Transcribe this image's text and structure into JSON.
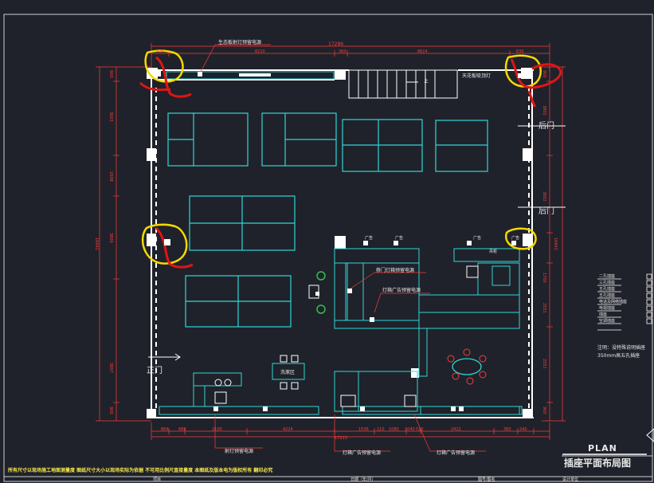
{
  "drawing": {
    "title_en": "PLAN",
    "title_cn": "插座平面布局图",
    "footer_note": "所有尺寸以现场施工地面测量度  图纸尺寸大小以现场实际为依据  不可用比例尺直接量度  本图纸及版本电为版权所有  翻印必究",
    "footer_cells": [
      "项目",
      "日期（年/月）",
      "图号/图名",
      "设计单位"
    ]
  },
  "dimensions": {
    "top_total": "17286",
    "top": [
      "636",
      "8210",
      "360",
      "8614",
      "630"
    ],
    "bottom": [
      "864",
      "680",
      "2100",
      "4224",
      "1536",
      "110",
      "1080",
      "1040",
      "510",
      "2422",
      "360",
      "240"
    ],
    "bottom_total": "17213",
    "left": [
      "900",
      "3603",
      "2008",
      "3800",
      "3807",
      "900"
    ],
    "left_total": "16642",
    "right": [
      "900",
      "3802",
      "3802",
      "1700",
      "2551",
      "2551",
      "900"
    ],
    "right_total": "16642"
  },
  "labels": {
    "ecology_board": "生态板射灯预留电源",
    "stair_note": "天花板吸顶灯",
    "up": "上",
    "back_door": "后门",
    "back_door_2": "后门",
    "main_door": "正门",
    "sliding_door": "移门灯箱预留电源",
    "lightbox_ad": "灯箱广告预留电源",
    "wash_area": "洗漱区",
    "ad_tag": "广告",
    "downlight": "射灯预留电源",
    "lightbox_ad_bottom_1": "灯箱广告预留电源",
    "lightbox_ad_bottom_2": "灯箱广告预留电源",
    "small_tag_1": "广告",
    "small_tag_2": "广告",
    "small_tag_3": "广告",
    "small_tag_4": "广告",
    "small_tag_5": "吊柜"
  },
  "legend": {
    "items": [
      "二孔插座",
      "三孔插座",
      "五孔插座",
      "五孔插座",
      "电话及网络插座",
      "电视插座",
      "插座",
      "空调插座"
    ],
    "note_line1": "注明：没特殊说明插座",
    "note_line2": "350mm高五孔插座"
  },
  "colors": {
    "background": "#1f222a",
    "wall": "#ffffff",
    "furniture": "#2fd7d7",
    "dimension": "#ff3b3b",
    "highlight": "#f5d800",
    "markup": "#e01515"
  }
}
